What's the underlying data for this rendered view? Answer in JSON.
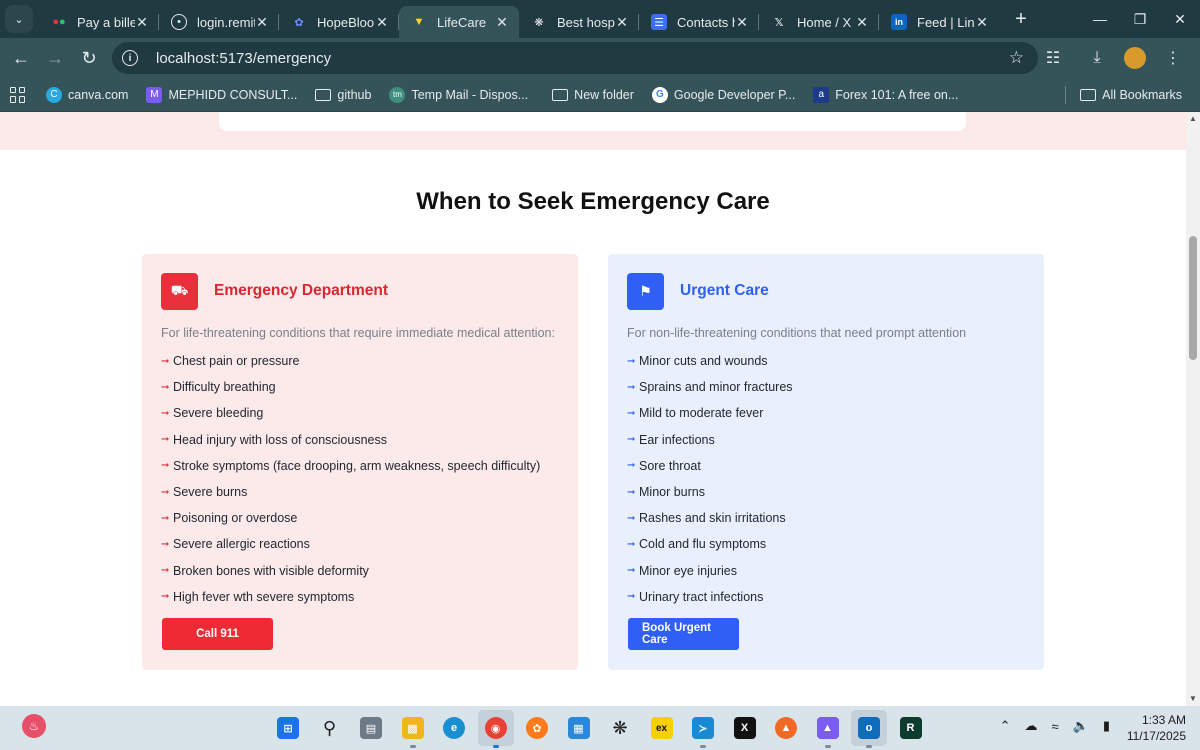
{
  "browser": {
    "tabs": [
      {
        "title": "Pay a biller",
        "icon": "colored-dots-icon",
        "active": false
      },
      {
        "title": "login.remit",
        "icon": "globe-icon",
        "active": false
      },
      {
        "title": "HopeBloom",
        "icon": "hopebloom-icon",
        "active": false
      },
      {
        "title": "LifeCare",
        "icon": "vite-icon",
        "active": true
      },
      {
        "title": "Best hospi",
        "icon": "openai-icon",
        "active": false
      },
      {
        "title": "Contacts h",
        "icon": "forms-icon",
        "active": false
      },
      {
        "title": "Home / X",
        "icon": "x-logo-icon",
        "active": false
      },
      {
        "title": "Feed | Link",
        "icon": "linkedin-icon",
        "active": false
      }
    ],
    "url": "localhost:5173/emergency",
    "bookmarks": [
      {
        "label": "canva.com",
        "icon": "canva-icon"
      },
      {
        "label": "MEPHIDD CONSULT...",
        "icon": "mephidd-icon"
      },
      {
        "label": "github",
        "icon": "folder-icon"
      },
      {
        "label": "Temp Mail - Dispos...",
        "icon": "tempmail-icon"
      },
      {
        "label": "New folder",
        "icon": "folder-icon"
      },
      {
        "label": "Google Developer P...",
        "icon": "google-icon"
      },
      {
        "label": "Forex 101: A free on...",
        "icon": "forex-icon"
      }
    ],
    "all_bookmarks": "All Bookmarks"
  },
  "page": {
    "section_title": "When to Seek Emergency Care",
    "emergency": {
      "title": "Emergency Department",
      "description": "For life-threatening conditions that require immediate medical attention:",
      "items": [
        "Chest pain or pressure",
        "Difficulty breathing",
        "Severe bleeding",
        "Head injury with loss of consciousness",
        "Stroke symptoms (face drooping, arm weakness, speech difficulty)",
        "Severe burns",
        "Poisoning or overdose",
        "Severe allergic reactions",
        "Broken bones with visible deformity",
        "High fever wth severe symptoms"
      ],
      "button": "Call 911",
      "accent": "#e8303a"
    },
    "urgent": {
      "title": "Urgent Care",
      "description": "For non-life-threatening conditions that need prompt attention",
      "items": [
        "Minor cuts and wounds",
        "Sprains and minor fractures",
        "Mild to moderate fever",
        "Ear infections",
        "Sore throat",
        "Minor burns",
        "Rashes and skin irritations",
        "Cold and flu symptoms",
        "Minor eye injuries",
        "Urinary tract infections"
      ],
      "button": "Book Urgent Care",
      "accent": "#2f5ff5"
    }
  },
  "taskbar": {
    "apps": [
      "windows-start-icon",
      "search-icon",
      "task-view-icon",
      "file-explorer-icon",
      "edge-icon",
      "chrome-icon",
      "firefox-icon",
      "store-icon",
      "chatgpt-icon",
      "exness-icon",
      "vscode-icon",
      "x-app-icon",
      "brave-icon",
      "affinity-icon",
      "outlook-icon",
      "r-icon"
    ],
    "time": "1:33 AM",
    "date": "11/17/2025"
  }
}
